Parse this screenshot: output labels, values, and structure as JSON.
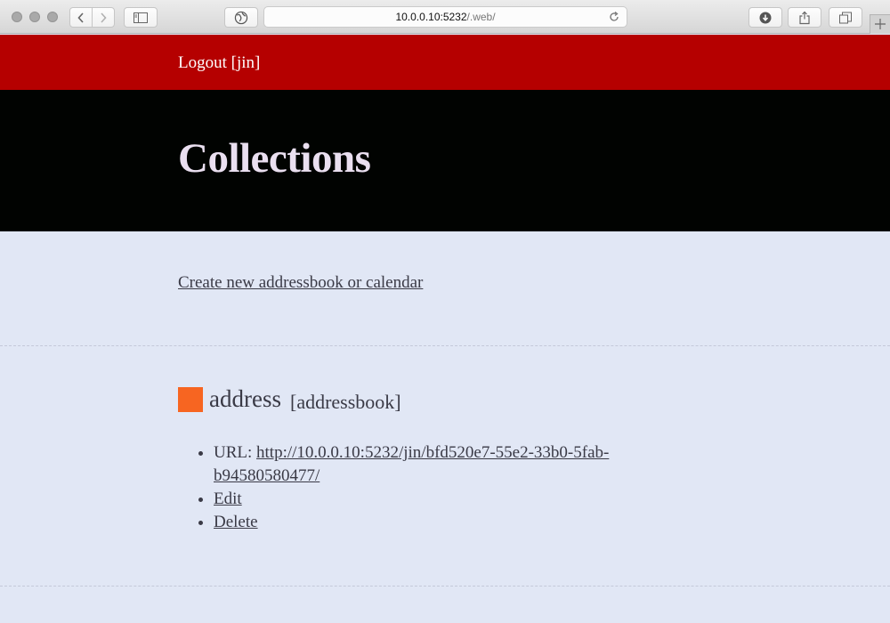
{
  "browser": {
    "address_host": "10.0.0.10:5232",
    "address_path": "/.web/",
    "icons": [
      "back-icon",
      "forward-icon",
      "sidebar-icon",
      "globe-icon",
      "reload-icon",
      "download-icon",
      "share-icon",
      "tabs-icon",
      "plus-icon"
    ]
  },
  "header": {
    "logout_label": "Logout [jin]"
  },
  "hero": {
    "title": "Collections"
  },
  "content": {
    "create_link": "Create new addressbook or calendar",
    "collection": {
      "color": "#f76521",
      "name": "address",
      "type": "[addressbook]",
      "url_label": "URL: ",
      "url": "http://10.0.0.10:5232/jin/bfd520e7-55e2-33b0-5fab-b94580580477/",
      "edit_label": "Edit",
      "delete_label": "Delete"
    }
  },
  "colors": {
    "logout_bar": "#b50000",
    "hero_bg": "#010301",
    "page_bg": "#e1e7f5",
    "accent": "#f76521"
  }
}
